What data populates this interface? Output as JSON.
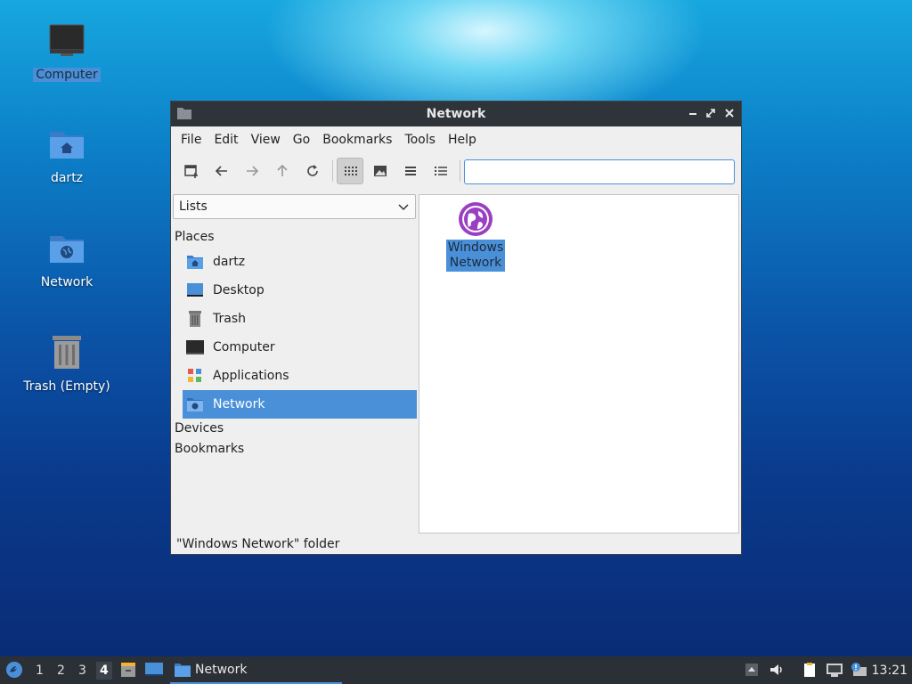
{
  "desktop": {
    "icons": [
      {
        "label": "Computer",
        "selected": true
      },
      {
        "label": "dartz"
      },
      {
        "label": "Network"
      },
      {
        "label": "Trash (Empty)"
      }
    ]
  },
  "window": {
    "title": "Network",
    "menu": [
      "File",
      "Edit",
      "View",
      "Go",
      "Bookmarks",
      "Tools",
      "Help"
    ],
    "address_value": "",
    "sidebar": {
      "view_select": "Lists",
      "sections": {
        "places": "Places",
        "devices": "Devices",
        "bookmarks": "Bookmarks"
      },
      "places": [
        {
          "label": "dartz",
          "icon": "home-folder-icon"
        },
        {
          "label": "Desktop",
          "icon": "desktop-icon"
        },
        {
          "label": "Trash",
          "icon": "trash-icon"
        },
        {
          "label": "Computer",
          "icon": "computer-icon"
        },
        {
          "label": "Applications",
          "icon": "applications-icon"
        },
        {
          "label": "Network",
          "icon": "network-folder-icon",
          "selected": true
        }
      ]
    },
    "content": {
      "items": [
        {
          "label": "Windows Network",
          "icon": "windows-network-icon",
          "selected": true
        }
      ]
    },
    "status": "\"Windows Network\" folder"
  },
  "taskbar": {
    "workspaces": [
      "1",
      "2",
      "3",
      "4"
    ],
    "current_workspace": "4",
    "task_label": "Network",
    "clock": "13:21"
  },
  "colors": {
    "accent": "#4a90d9",
    "titlebar": "#2f343b",
    "taskbar": "#2b3036"
  }
}
